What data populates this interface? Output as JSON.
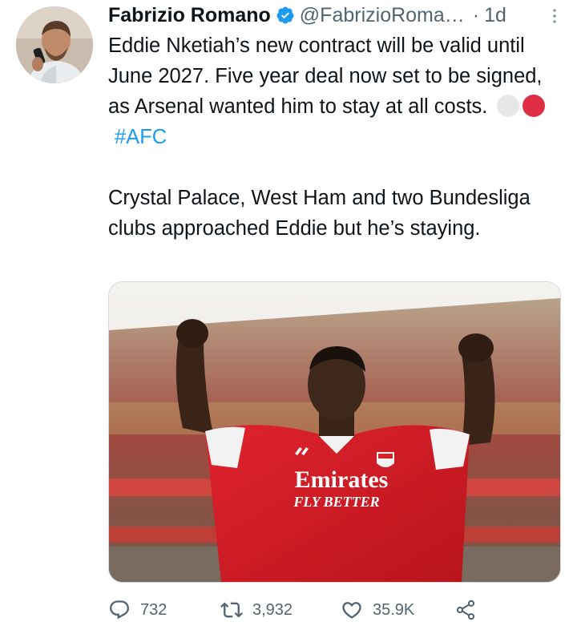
{
  "author": {
    "name": "Fabrizio Romano",
    "handle": "@FabrizioRoma…",
    "separator": "·",
    "timestamp": "1d"
  },
  "tweet": {
    "paragraph1": "Eddie Nketiah’s new contract will be valid until June 2027. Five year deal now set to be signed, as Arsenal wanted him to stay at all costs.",
    "hashtag": "#AFC",
    "paragraph2": "Crystal Palace, West Ham and two Bundesliga clubs approached Eddie but he’s staying.",
    "emoji_colors": [
      "#e6e7e8",
      "#dd2e44"
    ]
  },
  "media": {
    "shirt_sponsor": "Emirates",
    "shirt_slogan": "FLY BETTER"
  },
  "actions": {
    "replies": "732",
    "retweets": "3,932",
    "likes": "35.9K"
  },
  "colors": {
    "link": "#1d9bf0",
    "secondary": "#536471",
    "arsenal_red": "#d6202a"
  }
}
